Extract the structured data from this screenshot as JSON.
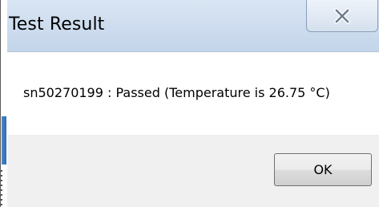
{
  "window": {
    "title": "Test Result",
    "close_icon": "close-x-icon"
  },
  "content": {
    "message": "sn50270199 : Passed (Temperature is 26.75 °C)"
  },
  "footer": {
    "ok_label": "OK"
  },
  "colors": {
    "titlebar_top": "#d9e6f4",
    "titlebar_bottom": "#c4d5ea",
    "content_bg": "#ffffff",
    "footer_bg": "#f0f0f0",
    "button_border": "#707070"
  }
}
